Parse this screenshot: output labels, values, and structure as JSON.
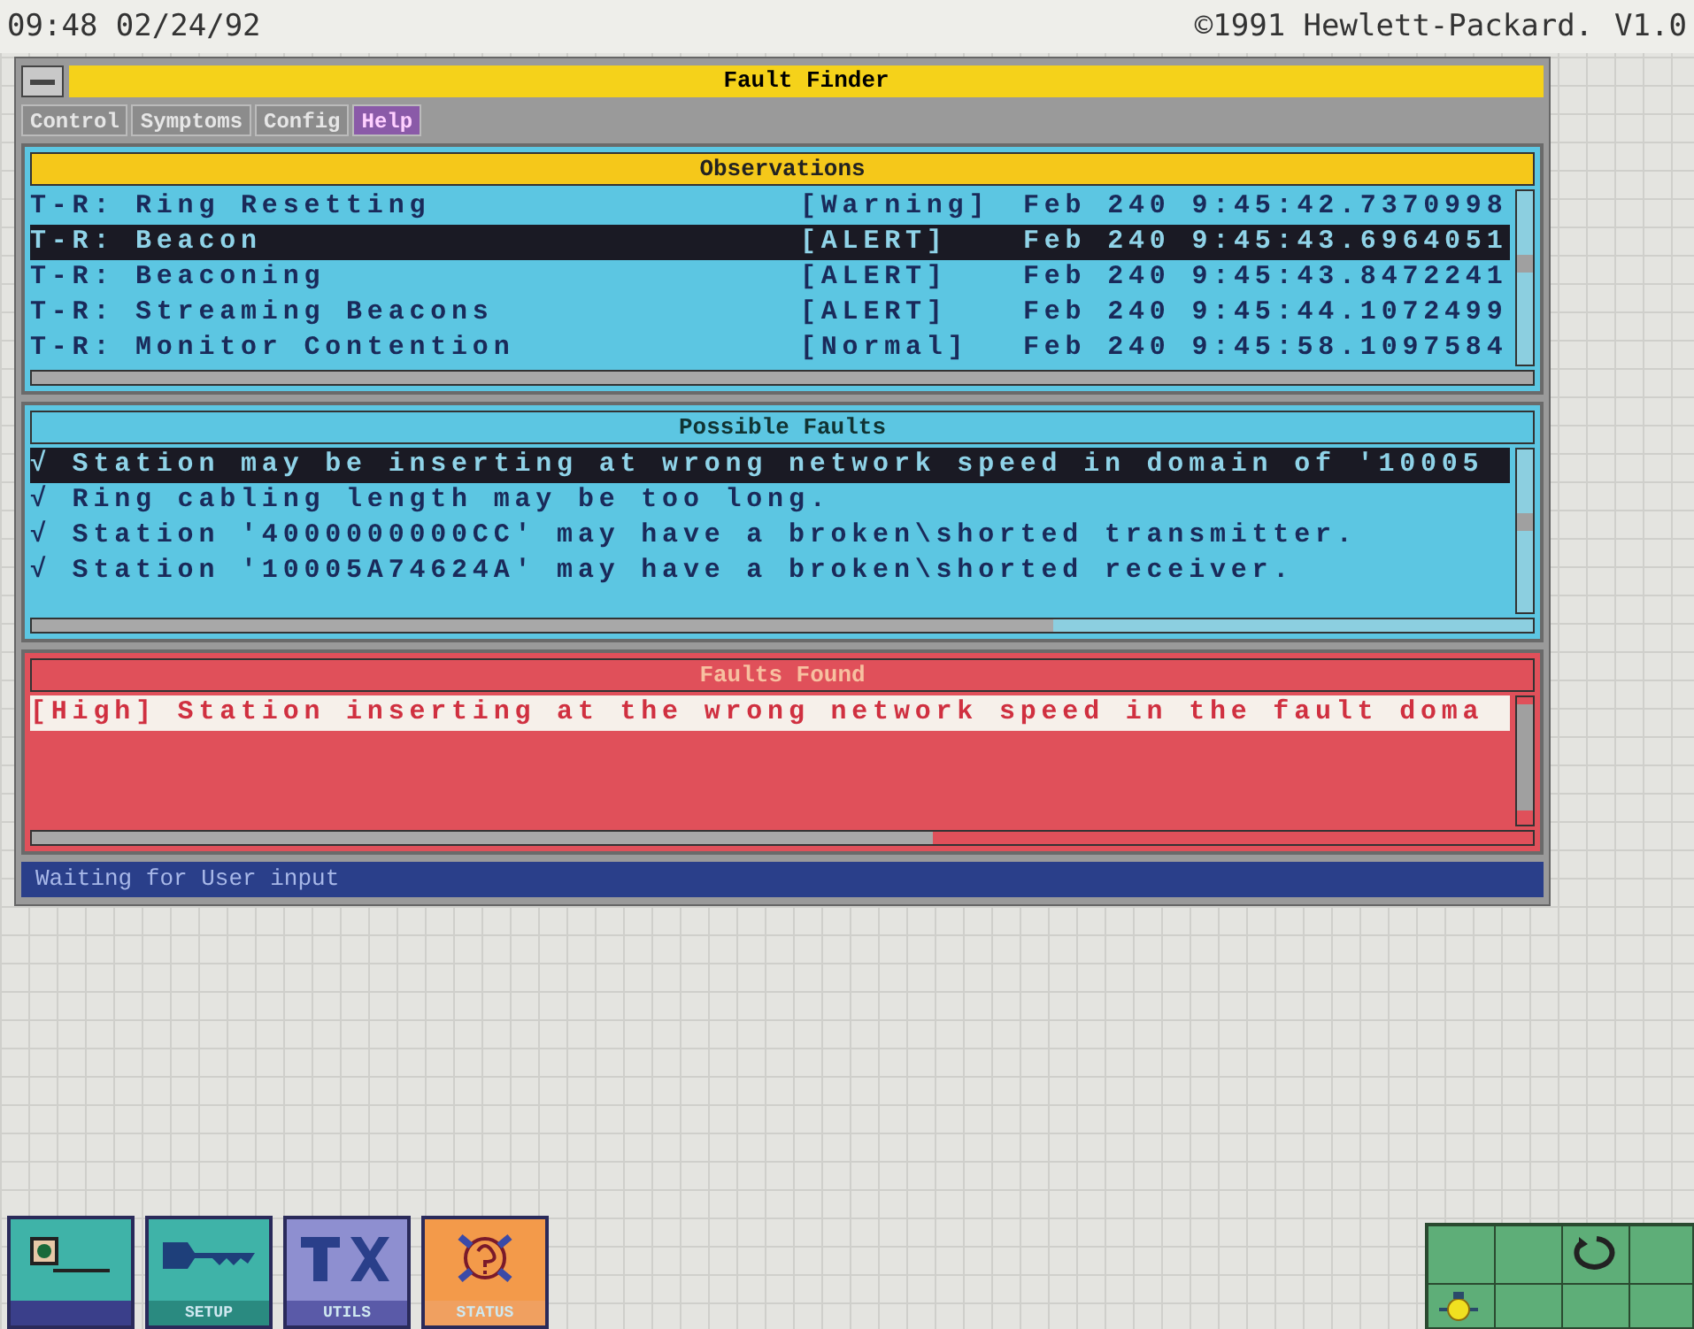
{
  "top_bar": {
    "clock": "09:48 02/24/92",
    "copyright": "©1991 Hewlett-Packard.",
    "version": "V1.0"
  },
  "window": {
    "title": "Fault Finder"
  },
  "menu": [
    {
      "label": "Control",
      "selected": false
    },
    {
      "label": "Symptoms",
      "selected": false
    },
    {
      "label": "Config",
      "selected": false
    },
    {
      "label": "Help",
      "selected": true
    }
  ],
  "observations": {
    "title": "Observations",
    "rows": [
      {
        "name": "T-R: Ring Resetting",
        "severity": "[Warning]",
        "time": "Feb 240 9:45:42.7370998",
        "selected": false
      },
      {
        "name": "T-R: Beacon",
        "severity": "[ALERT]",
        "time": "Feb 240 9:45:43.6964051",
        "selected": true
      },
      {
        "name": "T-R: Beaconing",
        "severity": "[ALERT]",
        "time": "Feb 240 9:45:43.8472241",
        "selected": false
      },
      {
        "name": "T-R: Streaming Beacons",
        "severity": "[ALERT]",
        "time": "Feb 240 9:45:44.1072499",
        "selected": false
      },
      {
        "name": "T-R: Monitor Contention",
        "severity": "[Normal]",
        "time": "Feb 240 9:45:58.1097584",
        "selected": false
      }
    ]
  },
  "possible_faults": {
    "title": "Possible Faults",
    "rows": [
      {
        "mark": "√",
        "text": "Station may be inserting at wrong network speed in domain of '10005",
        "selected": true
      },
      {
        "mark": "√",
        "text": "Ring cabling length may be too long.",
        "selected": false
      },
      {
        "mark": "√",
        "text": "Station '4000000000CC' may have a broken\\shorted transmitter.",
        "selected": false
      },
      {
        "mark": "√",
        "text": "Station '10005A74624A' may have a broken\\shorted receiver.",
        "selected": false
      }
    ]
  },
  "faults_found": {
    "title": "Faults Found",
    "rows": [
      {
        "text": "[High] Station inserting at the wrong network speed in the fault doma",
        "selected": true
      }
    ]
  },
  "status_bar": "Waiting for User input",
  "taskbar": [
    {
      "kind": "measure"
    },
    {
      "kind": "setup",
      "label": "SETUP"
    },
    {
      "kind": "utils",
      "label": "UTILS"
    },
    {
      "kind": "status",
      "label": "STATUS"
    }
  ]
}
